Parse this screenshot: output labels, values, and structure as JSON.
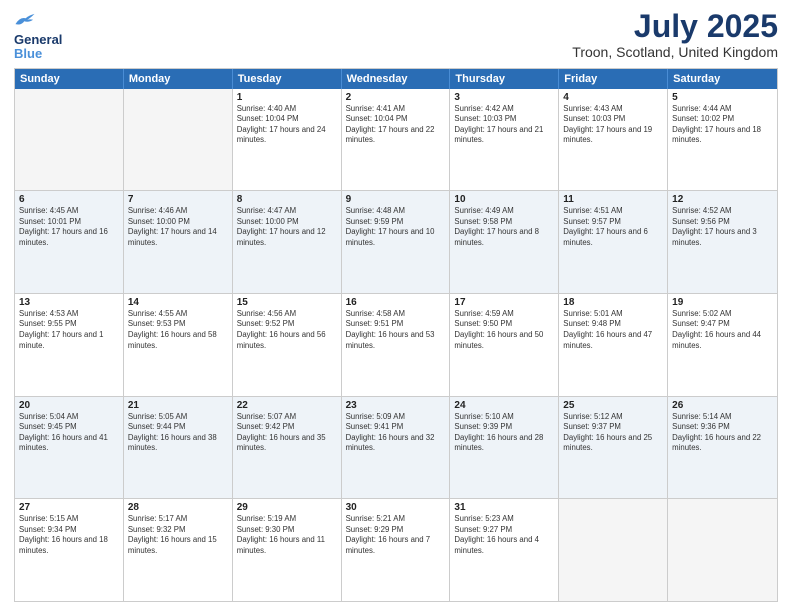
{
  "header": {
    "logo_line1": "General",
    "logo_line2": "Blue",
    "title": "July 2025",
    "subtitle": "Troon, Scotland, United Kingdom"
  },
  "days": [
    "Sunday",
    "Monday",
    "Tuesday",
    "Wednesday",
    "Thursday",
    "Friday",
    "Saturday"
  ],
  "rows": [
    [
      {
        "day": "",
        "info": ""
      },
      {
        "day": "",
        "info": ""
      },
      {
        "day": "1",
        "info": "Sunrise: 4:40 AM\nSunset: 10:04 PM\nDaylight: 17 hours and 24 minutes."
      },
      {
        "day": "2",
        "info": "Sunrise: 4:41 AM\nSunset: 10:04 PM\nDaylight: 17 hours and 22 minutes."
      },
      {
        "day": "3",
        "info": "Sunrise: 4:42 AM\nSunset: 10:03 PM\nDaylight: 17 hours and 21 minutes."
      },
      {
        "day": "4",
        "info": "Sunrise: 4:43 AM\nSunset: 10:03 PM\nDaylight: 17 hours and 19 minutes."
      },
      {
        "day": "5",
        "info": "Sunrise: 4:44 AM\nSunset: 10:02 PM\nDaylight: 17 hours and 18 minutes."
      }
    ],
    [
      {
        "day": "6",
        "info": "Sunrise: 4:45 AM\nSunset: 10:01 PM\nDaylight: 17 hours and 16 minutes."
      },
      {
        "day": "7",
        "info": "Sunrise: 4:46 AM\nSunset: 10:00 PM\nDaylight: 17 hours and 14 minutes."
      },
      {
        "day": "8",
        "info": "Sunrise: 4:47 AM\nSunset: 10:00 PM\nDaylight: 17 hours and 12 minutes."
      },
      {
        "day": "9",
        "info": "Sunrise: 4:48 AM\nSunset: 9:59 PM\nDaylight: 17 hours and 10 minutes."
      },
      {
        "day": "10",
        "info": "Sunrise: 4:49 AM\nSunset: 9:58 PM\nDaylight: 17 hours and 8 minutes."
      },
      {
        "day": "11",
        "info": "Sunrise: 4:51 AM\nSunset: 9:57 PM\nDaylight: 17 hours and 6 minutes."
      },
      {
        "day": "12",
        "info": "Sunrise: 4:52 AM\nSunset: 9:56 PM\nDaylight: 17 hours and 3 minutes."
      }
    ],
    [
      {
        "day": "13",
        "info": "Sunrise: 4:53 AM\nSunset: 9:55 PM\nDaylight: 17 hours and 1 minute."
      },
      {
        "day": "14",
        "info": "Sunrise: 4:55 AM\nSunset: 9:53 PM\nDaylight: 16 hours and 58 minutes."
      },
      {
        "day": "15",
        "info": "Sunrise: 4:56 AM\nSunset: 9:52 PM\nDaylight: 16 hours and 56 minutes."
      },
      {
        "day": "16",
        "info": "Sunrise: 4:58 AM\nSunset: 9:51 PM\nDaylight: 16 hours and 53 minutes."
      },
      {
        "day": "17",
        "info": "Sunrise: 4:59 AM\nSunset: 9:50 PM\nDaylight: 16 hours and 50 minutes."
      },
      {
        "day": "18",
        "info": "Sunrise: 5:01 AM\nSunset: 9:48 PM\nDaylight: 16 hours and 47 minutes."
      },
      {
        "day": "19",
        "info": "Sunrise: 5:02 AM\nSunset: 9:47 PM\nDaylight: 16 hours and 44 minutes."
      }
    ],
    [
      {
        "day": "20",
        "info": "Sunrise: 5:04 AM\nSunset: 9:45 PM\nDaylight: 16 hours and 41 minutes."
      },
      {
        "day": "21",
        "info": "Sunrise: 5:05 AM\nSunset: 9:44 PM\nDaylight: 16 hours and 38 minutes."
      },
      {
        "day": "22",
        "info": "Sunrise: 5:07 AM\nSunset: 9:42 PM\nDaylight: 16 hours and 35 minutes."
      },
      {
        "day": "23",
        "info": "Sunrise: 5:09 AM\nSunset: 9:41 PM\nDaylight: 16 hours and 32 minutes."
      },
      {
        "day": "24",
        "info": "Sunrise: 5:10 AM\nSunset: 9:39 PM\nDaylight: 16 hours and 28 minutes."
      },
      {
        "day": "25",
        "info": "Sunrise: 5:12 AM\nSunset: 9:37 PM\nDaylight: 16 hours and 25 minutes."
      },
      {
        "day": "26",
        "info": "Sunrise: 5:14 AM\nSunset: 9:36 PM\nDaylight: 16 hours and 22 minutes."
      }
    ],
    [
      {
        "day": "27",
        "info": "Sunrise: 5:15 AM\nSunset: 9:34 PM\nDaylight: 16 hours and 18 minutes."
      },
      {
        "day": "28",
        "info": "Sunrise: 5:17 AM\nSunset: 9:32 PM\nDaylight: 16 hours and 15 minutes."
      },
      {
        "day": "29",
        "info": "Sunrise: 5:19 AM\nSunset: 9:30 PM\nDaylight: 16 hours and 11 minutes."
      },
      {
        "day": "30",
        "info": "Sunrise: 5:21 AM\nSunset: 9:29 PM\nDaylight: 16 hours and 7 minutes."
      },
      {
        "day": "31",
        "info": "Sunrise: 5:23 AM\nSunset: 9:27 PM\nDaylight: 16 hours and 4 minutes."
      },
      {
        "day": "",
        "info": ""
      },
      {
        "day": "",
        "info": ""
      }
    ]
  ]
}
